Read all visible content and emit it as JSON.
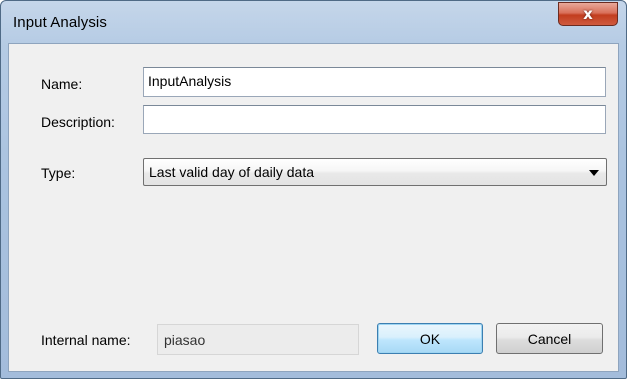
{
  "window": {
    "title": "Input Analysis",
    "close_glyph": "x"
  },
  "form": {
    "name_label": "Name:",
    "name_value": "InputAnalysis",
    "description_label": "Description:",
    "description_value": "",
    "type_label": "Type:",
    "type_selected": "Last valid day of daily data",
    "internal_name_label": "Internal name:",
    "internal_name_value": "piasao"
  },
  "buttons": {
    "ok_label": "OK",
    "cancel_label": "Cancel"
  },
  "icons": {
    "close": "close-icon",
    "dropdown": "chevron-down-icon"
  }
}
